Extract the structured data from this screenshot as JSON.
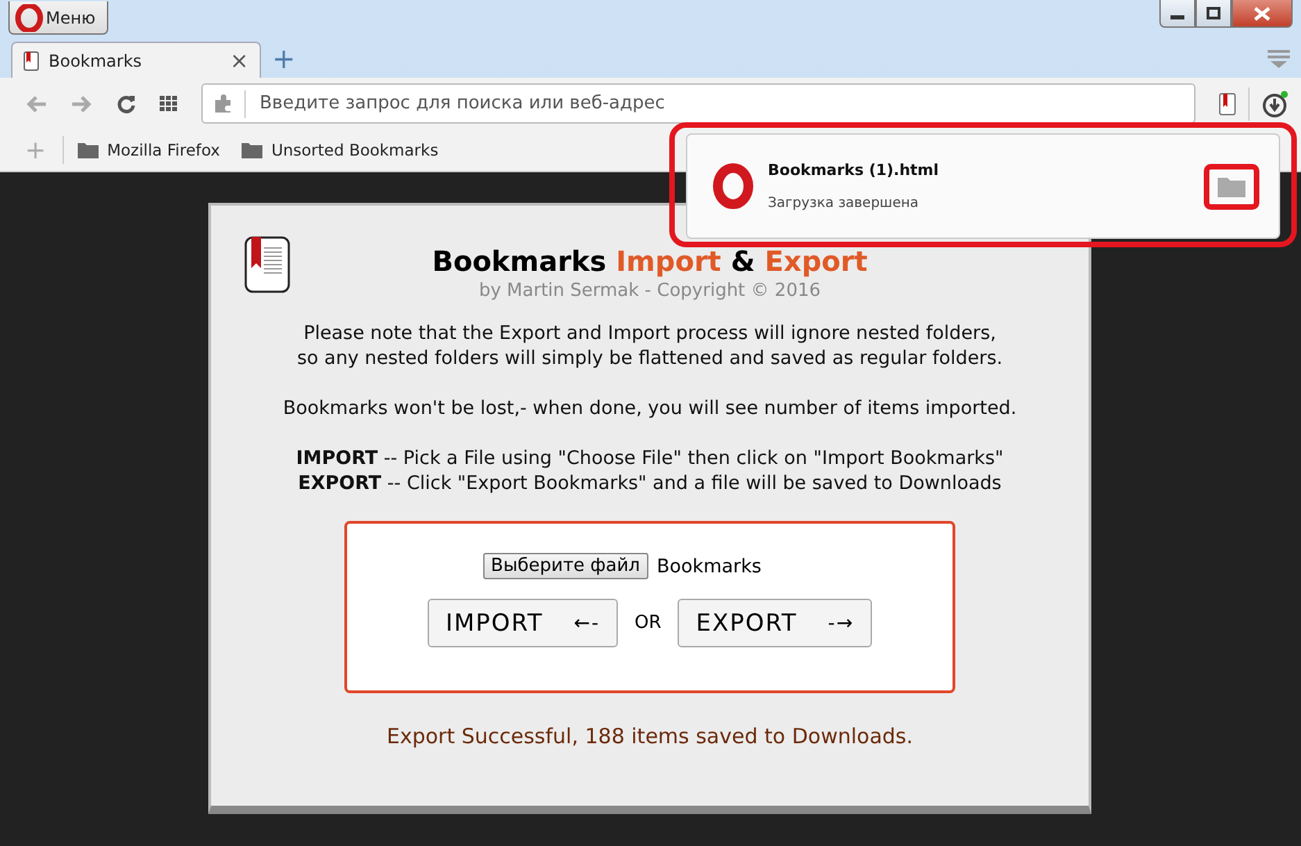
{
  "window": {
    "menu_label": "Меню"
  },
  "tabs": [
    {
      "label": "Bookmarks",
      "selected": true,
      "close": "×"
    }
  ],
  "new_tab": "+",
  "address_bar": {
    "placeholder": "Введите запрос для поиска или веб-адрес"
  },
  "bookmarks_bar": {
    "add": "+",
    "items": [
      {
        "label": "Mozilla Firefox"
      },
      {
        "label": "Unsorted Bookmarks"
      }
    ]
  },
  "download_popup": {
    "filename": "Bookmarks (1).html",
    "status": "Загрузка завершена",
    "highlighted": true
  },
  "page": {
    "title": [
      {
        "text": "Bookmarks ",
        "kind": "plain"
      },
      {
        "text": "Import",
        "kind": "accent"
      },
      {
        "text": " & ",
        "kind": "plain"
      },
      {
        "text": "Export",
        "kind": "accent"
      }
    ],
    "byline": "by Martin Sermak - Copyright © 2016",
    "notes": [
      "Please note that the Export and Import process will ignore nested folders,",
      "so any nested folders will simply be flattened and saved as regular folders."
    ],
    "note2": "Bookmarks won't be lost,- when done, you will see number of items imported.",
    "instructions": [
      "**IMPORT** -- Pick a File using \"Choose File\" then click on \"Import Bookmarks\"",
      "**EXPORT** -- Click \"Export Bookmarks\" and a file will be saved to Downloads"
    ],
    "file_button": "Выберите файл",
    "file_name": "Bookmarks",
    "import_button": {
      "label": "IMPORT",
      "arrow": "←-"
    },
    "or": "OR",
    "export_button": {
      "label": "EXPORT",
      "arrow": "-→"
    },
    "status": "Export Successful, 188 items saved to Downloads."
  }
}
